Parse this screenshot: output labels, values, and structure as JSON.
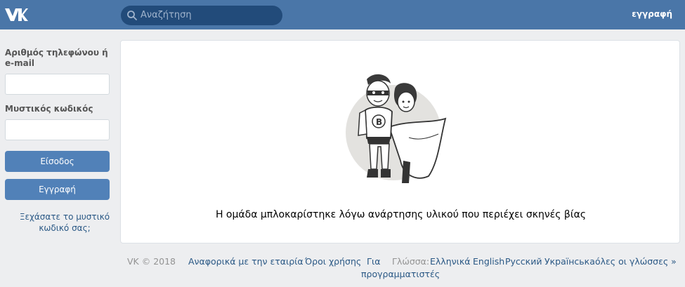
{
  "header": {
    "logo_icon": "vk-logo-icon",
    "search": {
      "placeholder": "Αναζήτηση",
      "icon": "search-icon"
    },
    "signup_link": "εγγραφή"
  },
  "sidebar": {
    "phone_email_label": "Αριθμός τηλεφώνου ή e-mail",
    "password_label": "Μυστικός κωδικός",
    "phone_email_value": "",
    "password_value": "",
    "login_button": "Είσοδος",
    "register_button": "Εγγραφή",
    "forgot_link": "Ξεχάσατε το μυστικό κωδικό σας;"
  },
  "main": {
    "illustration_icon": "superhero-couple-illustration",
    "message": "Η ομάδα μπλοκαρίστηκε λόγω ανάρτησης υλικού που περιέχει σκηνές βίας"
  },
  "footer": {
    "copyright": "VK © 2018",
    "about": "Αναφορικά με την εταιρία",
    "terms": "Όροι χρήσης",
    "developers_line1": "Για",
    "developers_line2": "προγραμματιστές",
    "language_label": "Γλώσσα:",
    "languages": [
      "Ελληνικά",
      "English",
      "Русский",
      "Українська"
    ],
    "all_languages": "όλες οι γλώσσες »"
  },
  "colors": {
    "header_bg": "#4a76a8",
    "search_bg": "#224b7a",
    "button_bg": "#5181b8",
    "link": "#2a5885",
    "page_bg": "#edeef0"
  }
}
